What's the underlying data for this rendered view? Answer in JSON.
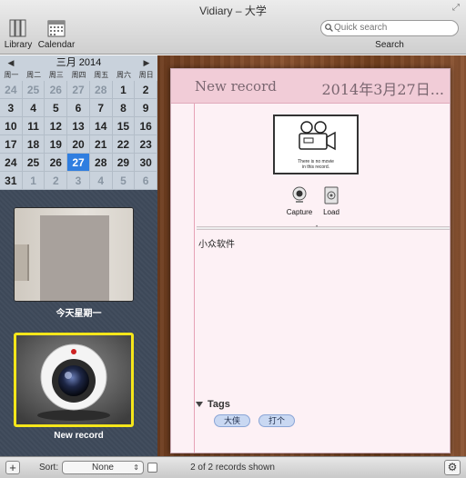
{
  "window": {
    "title": "Vidiary – 大学"
  },
  "toolbar": {
    "library_label": "Library",
    "calendar_label": "Calendar",
    "search_placeholder": "Quick search",
    "search_label": "Search"
  },
  "calendar": {
    "month_label": "三月 2014",
    "prev_icon": "◀",
    "next_icon": "▶",
    "weekdays": [
      "周一",
      "周二",
      "周三",
      "周四",
      "周五",
      "周六",
      "周日"
    ],
    "days": [
      {
        "d": "24",
        "m": true
      },
      {
        "d": "25",
        "m": true
      },
      {
        "d": "26",
        "m": true
      },
      {
        "d": "27",
        "m": true
      },
      {
        "d": "28",
        "m": true
      },
      {
        "d": "1",
        "m": false
      },
      {
        "d": "2",
        "m": false
      },
      {
        "d": "3",
        "m": false
      },
      {
        "d": "4",
        "m": false
      },
      {
        "d": "5",
        "m": false
      },
      {
        "d": "6",
        "m": false
      },
      {
        "d": "7",
        "m": false
      },
      {
        "d": "8",
        "m": false
      },
      {
        "d": "9",
        "m": false
      },
      {
        "d": "10",
        "m": false
      },
      {
        "d": "11",
        "m": false
      },
      {
        "d": "12",
        "m": false
      },
      {
        "d": "13",
        "m": false
      },
      {
        "d": "14",
        "m": false
      },
      {
        "d": "15",
        "m": false
      },
      {
        "d": "16",
        "m": false
      },
      {
        "d": "17",
        "m": false
      },
      {
        "d": "18",
        "m": false
      },
      {
        "d": "19",
        "m": false
      },
      {
        "d": "20",
        "m": false
      },
      {
        "d": "21",
        "m": false
      },
      {
        "d": "22",
        "m": false
      },
      {
        "d": "23",
        "m": false
      },
      {
        "d": "24",
        "m": false
      },
      {
        "d": "25",
        "m": false
      },
      {
        "d": "26",
        "m": false
      },
      {
        "d": "27",
        "m": false,
        "today": true
      },
      {
        "d": "28",
        "m": false
      },
      {
        "d": "29",
        "m": false
      },
      {
        "d": "30",
        "m": false
      },
      {
        "d": "31",
        "m": false
      },
      {
        "d": "1",
        "m": true
      },
      {
        "d": "2",
        "m": true
      },
      {
        "d": "3",
        "m": true
      },
      {
        "d": "4",
        "m": true
      },
      {
        "d": "5",
        "m": true
      },
      {
        "d": "6",
        "m": true
      }
    ]
  },
  "records": [
    {
      "label": "今天星期一"
    },
    {
      "label": "New record"
    }
  ],
  "record": {
    "title": "New record",
    "date": "2014年3月27日...",
    "no_movie_line1": "There is no movie",
    "no_movie_line2": "in this record.",
    "capture_label": "Capture",
    "load_label": "Load",
    "note": "小众软件",
    "tags_heading": "Tags",
    "tags": [
      "大侠",
      "打个"
    ]
  },
  "bottom": {
    "add_label": "+",
    "sort_label": "Sort:",
    "sort_value": "None",
    "status": "2 of 2 records shown",
    "gear_label": "⚙"
  },
  "colors": {
    "sidebar_bg": "#3f4a5b",
    "selection_yellow": "#f5e61a",
    "today_blue": "#2f7ee0",
    "page_pink": "#fdf1f5"
  }
}
